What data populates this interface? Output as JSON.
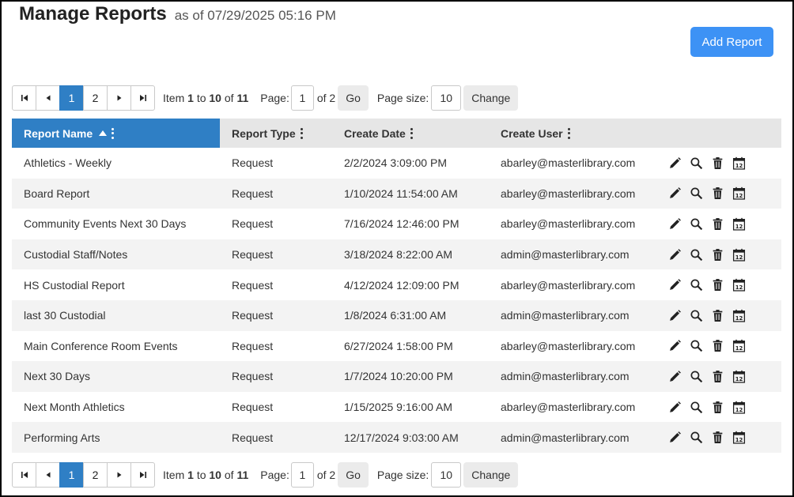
{
  "header": {
    "title": "Manage Reports",
    "as_of": "as of 07/29/2025 05:16 PM"
  },
  "add_button": "Add Report",
  "pager": {
    "pages": [
      "1",
      "2"
    ],
    "active_page": "1",
    "item_label": "Item",
    "item_from": "1",
    "to_label": "to",
    "item_to": "10",
    "of_label": "of",
    "total": "11",
    "page_label": "Page:",
    "page_value": "1",
    "of_pages": "of 2",
    "go_label": "Go",
    "size_label": "Page size:",
    "size_value": "10",
    "change_label": "Change"
  },
  "columns": {
    "name": "Report Name",
    "type": "Report Type",
    "date": "Create Date",
    "user": "Create User"
  },
  "rows": [
    {
      "name": "Athletics - Weekly",
      "type": "Request",
      "date": "2/2/2024 3:09:00 PM",
      "user": "abarley@masterlibrary.com"
    },
    {
      "name": "Board Report",
      "type": "Request",
      "date": "1/10/2024 11:54:00 AM",
      "user": "abarley@masterlibrary.com"
    },
    {
      "name": "Community Events Next 30 Days",
      "type": "Request",
      "date": "7/16/2024 12:46:00 PM",
      "user": "abarley@masterlibrary.com"
    },
    {
      "name": "Custodial Staff/Notes",
      "type": "Request",
      "date": "3/18/2024 8:22:00 AM",
      "user": "admin@masterlibrary.com"
    },
    {
      "name": "HS Custodial Report",
      "type": "Request",
      "date": "4/12/2024 12:09:00 PM",
      "user": "abarley@masterlibrary.com"
    },
    {
      "name": "last 30 Custodial",
      "type": "Request",
      "date": "1/8/2024 6:31:00 AM",
      "user": "admin@masterlibrary.com"
    },
    {
      "name": "Main Conference Room Events",
      "type": "Request",
      "date": "6/27/2024 1:58:00 PM",
      "user": "abarley@masterlibrary.com"
    },
    {
      "name": "Next 30 Days",
      "type": "Request",
      "date": "1/7/2024 10:20:00 PM",
      "user": "admin@masterlibrary.com"
    },
    {
      "name": "Next Month Athletics",
      "type": "Request",
      "date": "1/15/2025 9:16:00 AM",
      "user": "abarley@masterlibrary.com"
    },
    {
      "name": "Performing Arts",
      "type": "Request",
      "date": "12/17/2024 9:03:00 AM",
      "user": "admin@masterlibrary.com"
    }
  ],
  "icons": {
    "edit": "pencil-icon",
    "view": "magnifier-icon",
    "delete": "trash-icon",
    "schedule": "calendar-icon"
  },
  "colors": {
    "accent": "#2f7fc5",
    "button": "#3d92f5"
  }
}
